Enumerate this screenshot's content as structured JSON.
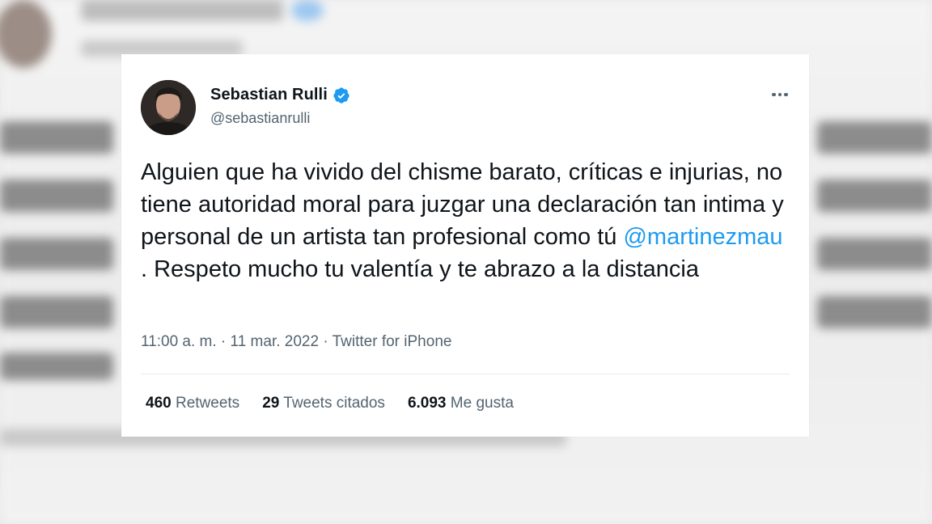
{
  "tweet": {
    "author_name": "Sebastian Rulli",
    "handle": "@sebastianrulli",
    "verified_icon": "verified-badge-icon",
    "more_icon": "more-options-icon",
    "text_before_mention": "Alguien que ha vivido del chisme barato, críticas e injurias, no tiene autoridad moral para juzgar una declaración tan intima y personal de un artista tan profesional como tú ",
    "mention": "@martinezmau",
    "text_after_mention": " . Respeto mucho tu valentía y te abrazo a la distancia",
    "time": "11:00 a. m.",
    "date": "11 mar. 2022",
    "source": "Twitter for iPhone",
    "separator": " · "
  },
  "stats": {
    "retweets_count": "460",
    "retweets_label": "Retweets",
    "quotes_count": "29",
    "quotes_label": "Tweets citados",
    "likes_count": "6.093",
    "likes_label": "Me gusta"
  },
  "colors": {
    "link": "#1d9bf0",
    "text": "#0f1419",
    "secondary": "#536471",
    "verified": "#1d9bf0"
  }
}
